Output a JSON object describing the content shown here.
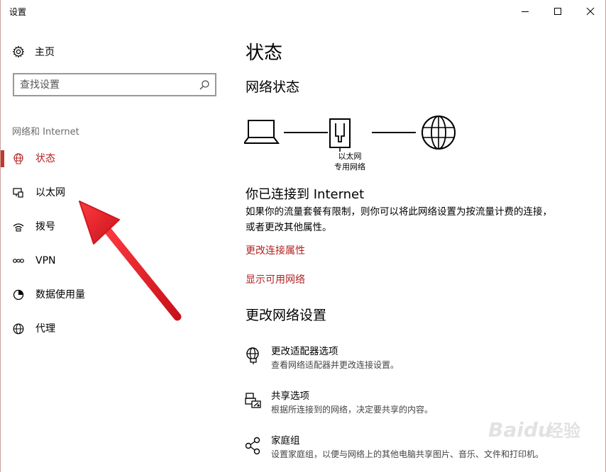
{
  "window": {
    "title": "设置"
  },
  "sidebar": {
    "home_label": "主页",
    "search_placeholder": "查找设置",
    "section_label": "网络和 Internet",
    "items": [
      {
        "label": "状态",
        "icon": "globe-network-icon",
        "active": true
      },
      {
        "label": "以太网",
        "icon": "ethernet-icon",
        "active": false
      },
      {
        "label": "拨号",
        "icon": "dialup-icon",
        "active": false
      },
      {
        "label": "VPN",
        "icon": "vpn-icon",
        "active": false
      },
      {
        "label": "数据使用量",
        "icon": "data-usage-icon",
        "active": false
      },
      {
        "label": "代理",
        "icon": "globe-icon",
        "active": false
      }
    ]
  },
  "main": {
    "title": "状态",
    "network_status_title": "网络状态",
    "diagram_caption_line1": "以太网",
    "diagram_caption_line2": "专用网络",
    "connected_title": "你已连接到 Internet",
    "connected_desc": "如果你的流量套餐有限制，则你可以将此网络设置为按流量计费的连接，或者更改其他属性。",
    "link_change_props": "更改连接属性",
    "link_show_networks": "显示可用网络",
    "change_settings_title": "更改网络设置",
    "options": [
      {
        "title": "更改适配器选项",
        "desc": "查看网络适配器并更改连接设置。",
        "icon": "adapter-icon"
      },
      {
        "title": "共享选项",
        "desc": "根据所连接到的网络，决定要共享的内容。",
        "icon": "sharing-icon"
      },
      {
        "title": "家庭组",
        "desc": "设置家庭组，以便与网络上的其他电脑共享图片、音乐、文件和打印机。",
        "icon": "homegroup-icon"
      }
    ]
  },
  "colors": {
    "accent": "#b22222",
    "annotation_arrow": "#e8262e"
  },
  "watermark": {
    "brand": "Baidu",
    "text": "经验"
  }
}
